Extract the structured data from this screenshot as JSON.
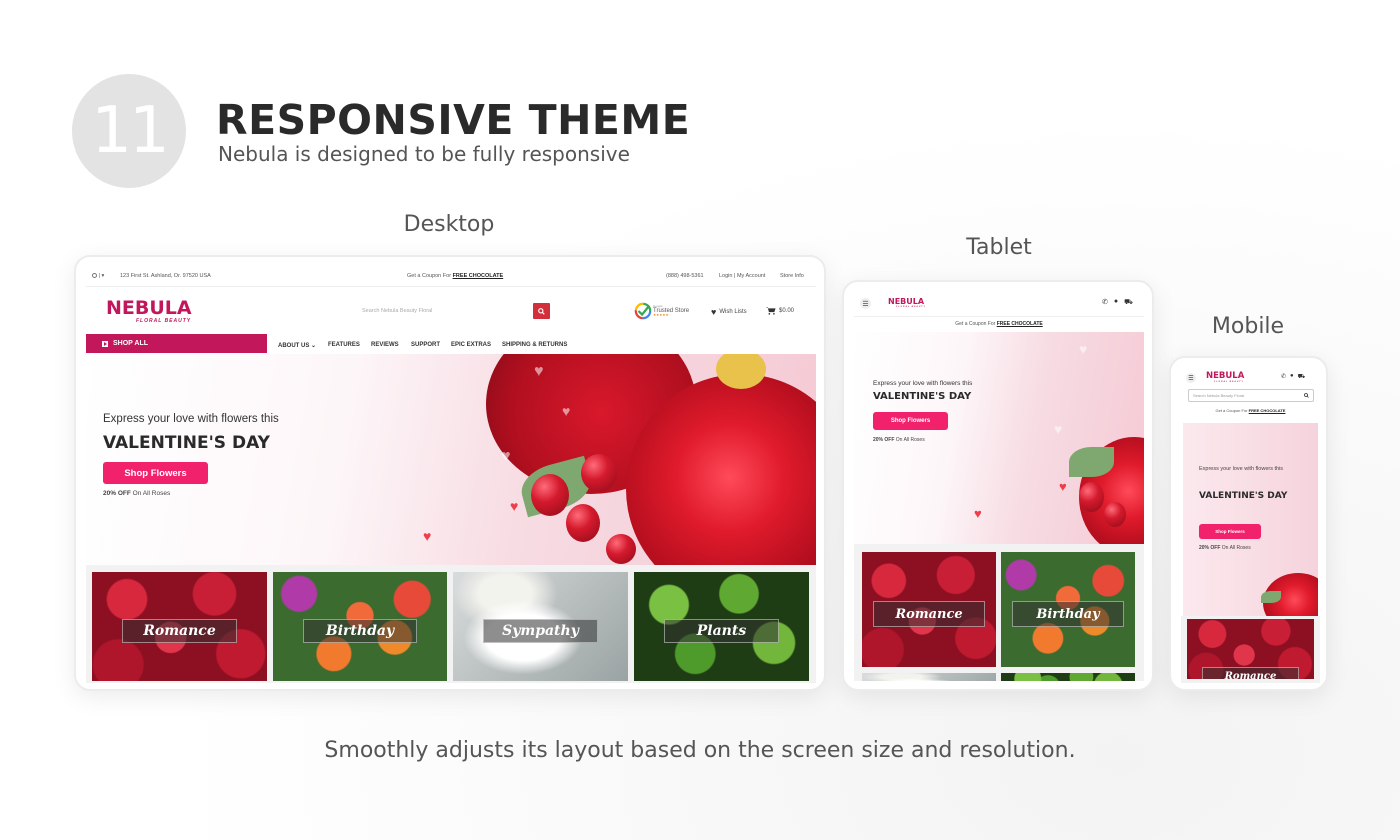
{
  "header": {
    "step_number": "11",
    "title": "RESPONSIVE THEME",
    "subtitle": "Nebula is designed to be fully responsive"
  },
  "device_labels": {
    "desktop": "Desktop",
    "tablet": "Tablet",
    "mobile": "Mobile"
  },
  "footer": {
    "text": "Smoothly adjusts its layout based on the screen size and resolution."
  },
  "brand": {
    "name": "NEBULA",
    "tagline": "FLORAL BEAUTY",
    "accent_color": "#c2185b",
    "button_color": "#f2216b"
  },
  "site": {
    "topbar": {
      "address": "123 First St. Ashland, Or. 97520 USA",
      "coupon_prefix": "Get a Coupon For",
      "coupon_link": "FREE CHOCOLATE",
      "phone": "(888) 498-5361",
      "account": "Login | My Account",
      "store_info": "Store Info"
    },
    "search": {
      "placeholder": "Search Nebula Beauty Floral"
    },
    "trusted_store": {
      "small": "Google",
      "label": "Trusted Store",
      "stars": "★★★★★"
    },
    "wish_lists": "Wish Lists",
    "cart_total": "$0.00",
    "nav": {
      "shop_all": "SHOP ALL",
      "links": [
        "ABOUT US ⌄",
        "FEATURES",
        "REVIEWS",
        "SUPPORT",
        "EPIC EXTRAS",
        "SHIPPING & RETURNS"
      ]
    },
    "hero": {
      "eyebrow": "Express your love with flowers this",
      "headline": "VALENTINE'S DAY",
      "cta": "Shop Flowers",
      "offer_bold": "20% OFF",
      "offer_rest": "On All Roses"
    },
    "categories": [
      "Romance",
      "Birthday",
      "Sympathy",
      "Plants"
    ]
  }
}
